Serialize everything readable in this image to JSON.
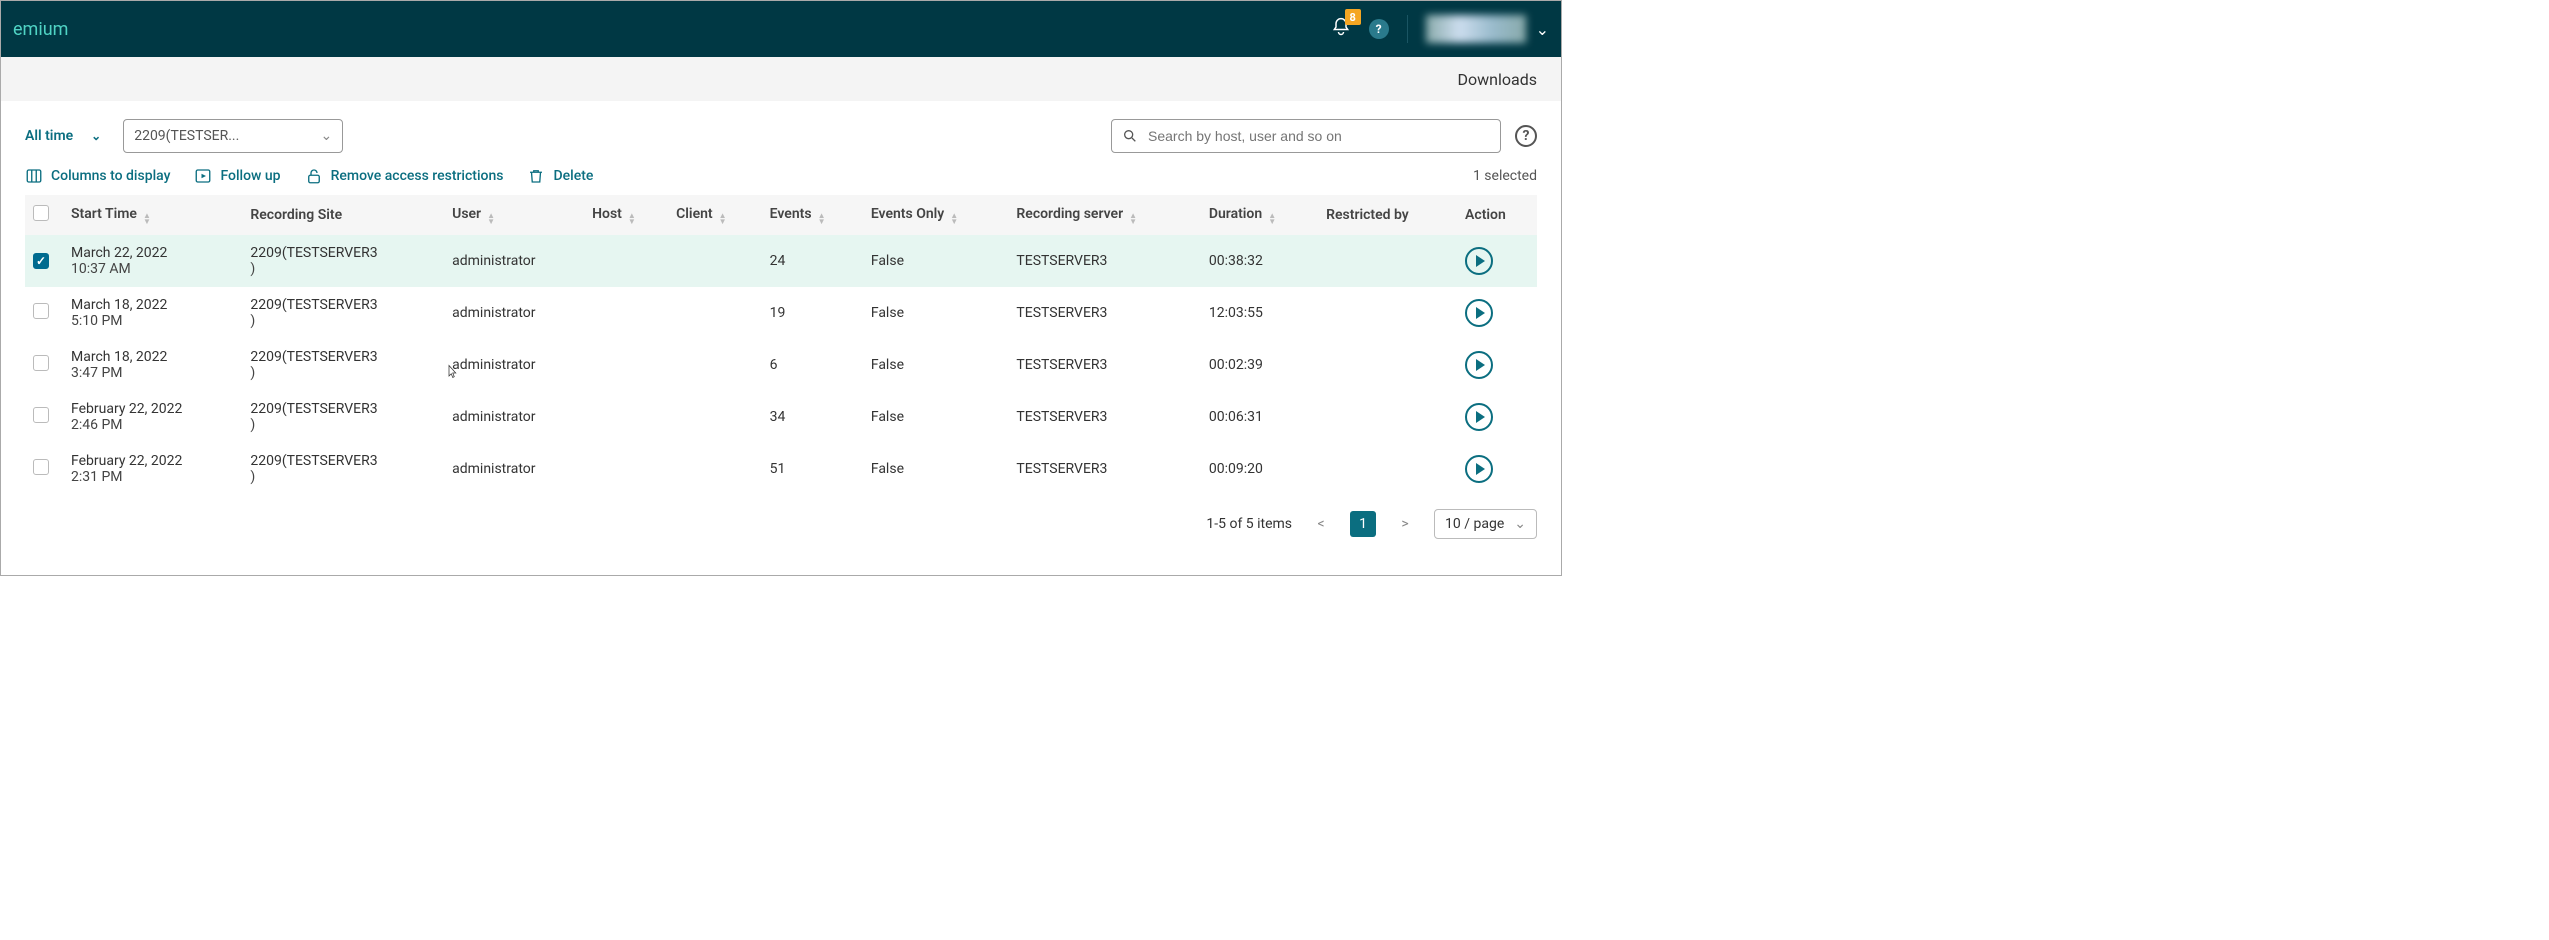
{
  "header": {
    "title_fragment": "emium",
    "notification_count": "8"
  },
  "subbar": {
    "downloads": "Downloads"
  },
  "filters": {
    "time_label": "All time",
    "site_selected": "2209(TESTSER...",
    "search_placeholder": "Search by host, user and so on"
  },
  "actions": {
    "columns": "Columns to display",
    "followup": "Follow up",
    "remove_restrictions": "Remove access restrictions",
    "delete": "Delete",
    "selected_text": "1 selected"
  },
  "columns": {
    "start_time": "Start Time",
    "recording_site": "Recording Site",
    "user": "User",
    "host": "Host",
    "client": "Client",
    "events": "Events",
    "events_only": "Events Only",
    "recording_server": "Recording server",
    "duration": "Duration",
    "restricted_by": "Restricted by",
    "action": "Action"
  },
  "rows": [
    {
      "checked": true,
      "start1": "March 22, 2022",
      "start2": "10:37 AM",
      "site1": "2209(TESTSERVER3",
      "site2": ")",
      "user": "administrator",
      "events": "24",
      "events_only": "False",
      "server": "TESTSERVER3",
      "duration": "00:38:32"
    },
    {
      "checked": false,
      "start1": "March 18, 2022",
      "start2": "5:10 PM",
      "site1": "2209(TESTSERVER3",
      "site2": ")",
      "user": "administrator",
      "events": "19",
      "events_only": "False",
      "server": "TESTSERVER3",
      "duration": "12:03:55"
    },
    {
      "checked": false,
      "start1": "March 18, 2022",
      "start2": "3:47 PM",
      "site1": "2209(TESTSERVER3",
      "site2": ")",
      "user": "administrator",
      "events": "6",
      "events_only": "False",
      "server": "TESTSERVER3",
      "duration": "00:02:39"
    },
    {
      "checked": false,
      "start1": "February 22, 2022",
      "start2": "2:46 PM",
      "site1": "2209(TESTSERVER3",
      "site2": ")",
      "user": "administrator",
      "events": "34",
      "events_only": "False",
      "server": "TESTSERVER3",
      "duration": "00:06:31"
    },
    {
      "checked": false,
      "start1": "February 22, 2022",
      "start2": "2:31 PM",
      "site1": "2209(TESTSERVER3",
      "site2": ")",
      "user": "administrator",
      "events": "51",
      "events_only": "False",
      "server": "TESTSERVER3",
      "duration": "00:09:20"
    }
  ],
  "pager": {
    "range_text": "1-5 of 5 items",
    "current_page": "1",
    "page_size_label": "10 / page"
  }
}
